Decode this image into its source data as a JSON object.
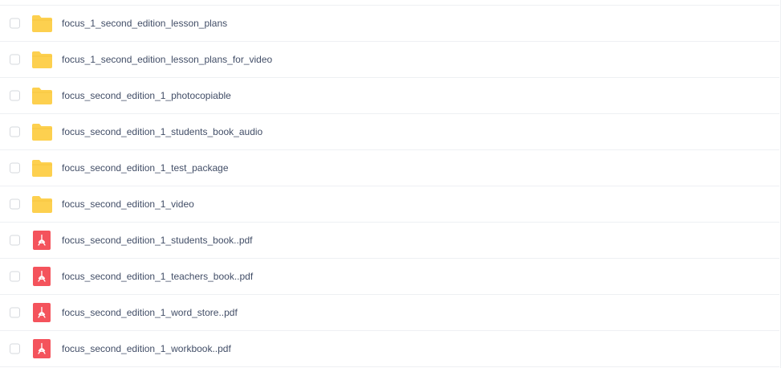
{
  "files": [
    {
      "name": "focus_1_second_edition_lesson_plans",
      "type": "folder",
      "icon": "folder-icon"
    },
    {
      "name": "focus_1_second_edition_lesson_plans_for_video",
      "type": "folder",
      "icon": "folder-icon"
    },
    {
      "name": "focus_second_edition_1_photocopiable",
      "type": "folder",
      "icon": "folder-icon"
    },
    {
      "name": "focus_second_edition_1_students_book_audio",
      "type": "folder",
      "icon": "folder-icon"
    },
    {
      "name": "focus_second_edition_1_test_package",
      "type": "folder",
      "icon": "folder-icon"
    },
    {
      "name": "focus_second_edition_1_video",
      "type": "folder",
      "icon": "folder-icon"
    },
    {
      "name": "focus_second_edition_1_students_book..pdf",
      "type": "pdf",
      "icon": "pdf-icon"
    },
    {
      "name": "focus_second_edition_1_teachers_book..pdf",
      "type": "pdf",
      "icon": "pdf-icon"
    },
    {
      "name": "focus_second_edition_1_word_store..pdf",
      "type": "pdf",
      "icon": "pdf-icon"
    },
    {
      "name": "focus_second_edition_1_workbook..pdf",
      "type": "pdf",
      "icon": "pdf-icon"
    }
  ],
  "colors": {
    "folder": "#fdd04f",
    "pdf": "#f4535c",
    "text": "#424e67",
    "border": "#eef0f3"
  }
}
